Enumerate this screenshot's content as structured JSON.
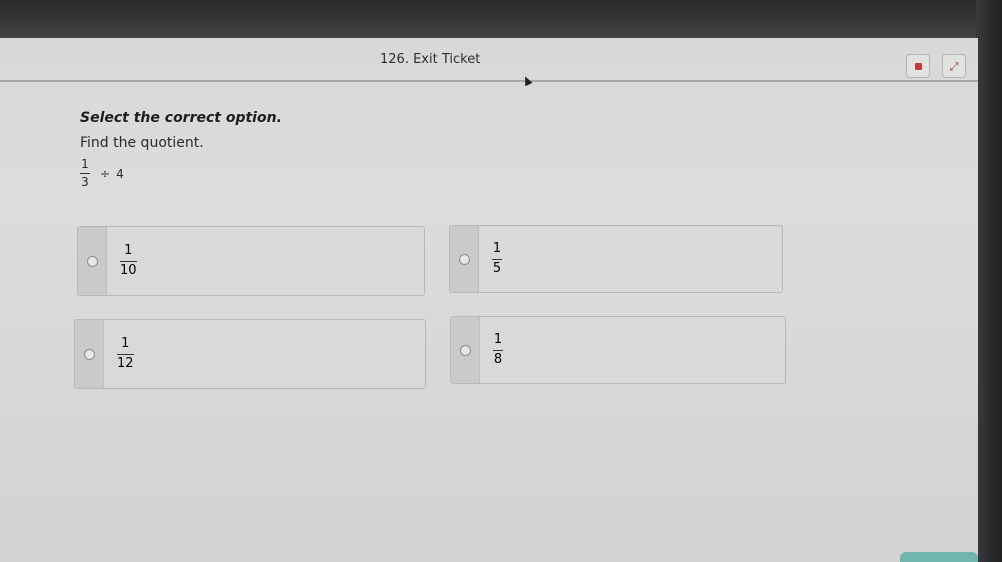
{
  "header": {
    "title": "126. Exit Ticket",
    "stop_icon": "stop-square-icon",
    "expand_icon": "expand-diagonal-icon",
    "accent_color": "#c63a3a"
  },
  "question": {
    "instruction": "Select the correct option.",
    "prompt": "Find the quotient.",
    "expression": {
      "numerator": "1",
      "denominator": "3",
      "operator": "÷",
      "operand": "4"
    }
  },
  "options": [
    {
      "numerator": "1",
      "denominator": "10"
    },
    {
      "numerator": "1",
      "denominator": "5"
    },
    {
      "numerator": "1",
      "denominator": "12"
    },
    {
      "numerator": "1",
      "denominator": "8"
    }
  ]
}
